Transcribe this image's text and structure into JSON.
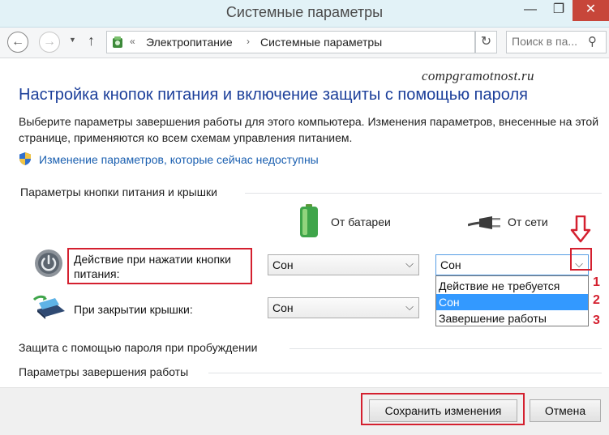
{
  "window": {
    "title": "Системные параметры",
    "minimize": "—",
    "maximize": "❐",
    "close": "✕"
  },
  "nav": {
    "back": "←",
    "forward": "→",
    "history": "▼",
    "up": "↑",
    "breadcrumb": [
      "Электропитание",
      "Системные параметры"
    ],
    "breadcrumb_sep": "›",
    "breadcrumb_lead": "«",
    "refresh": "↻",
    "search_placeholder": "Поиск в па...",
    "search_icon": "⚲"
  },
  "watermark": "compgramotnost.ru",
  "page": {
    "heading": "Настройка кнопок питания и включение защиты с помощью пароля",
    "description": "Выберите параметры завершения работы для этого компьютера. Изменения параметров, внесенные на этой странице, применяются ко всем схемам управления питанием.",
    "link": "Изменение параметров, которые сейчас недоступны"
  },
  "power_section": {
    "title": "Параметры кнопки питания и крышки",
    "col_battery": "От батареи",
    "col_ac": "От сети",
    "rows": [
      {
        "label": "Действие при нажатии кнопки питания:",
        "battery": "Сон",
        "ac": "Сон"
      },
      {
        "label": "При закрытии крышки:",
        "battery": "Сон"
      }
    ],
    "chevron": "⌵"
  },
  "dropdown": {
    "options": [
      "Действие не требуется",
      "Сон",
      "Завершение работы"
    ],
    "selected_index": 1,
    "numbers": [
      "1",
      "2",
      "3"
    ]
  },
  "sections": {
    "password": "Защита с помощью пароля при пробуждении",
    "shutdown": "Параметры завершения работы"
  },
  "footer": {
    "save": "Сохранить изменения",
    "cancel": "Отмена"
  },
  "colors": {
    "accent_red": "#d4202f",
    "heading_blue": "#1c3f9a",
    "link_blue": "#1a5fb0",
    "selection": "#3399ff"
  }
}
